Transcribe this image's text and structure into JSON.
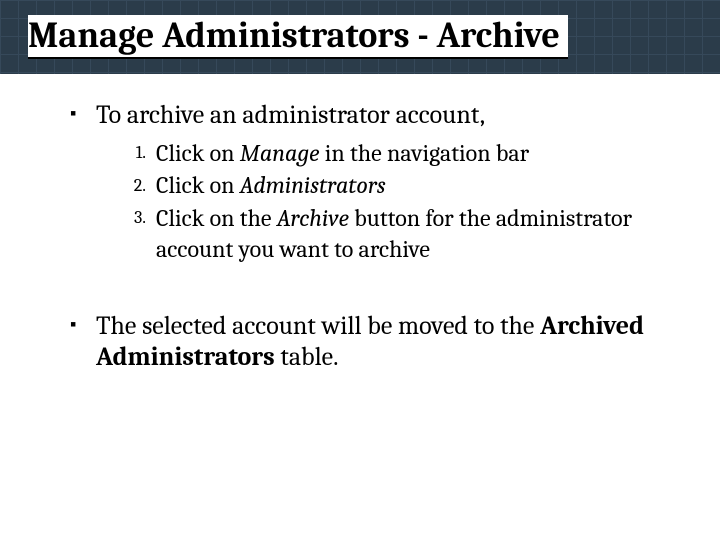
{
  "title": "Manage Administrators - Archive",
  "bullets": [
    {
      "text": "To archive an administrator account,",
      "steps": [
        {
          "pre": "Click on ",
          "emph": "Manage",
          "post": " in the navigation bar"
        },
        {
          "pre": "Click on ",
          "emph": "Administrators"
        },
        {
          "pre": "Click on the ",
          "emph": "Archive",
          "post": " button for the administrator account you want to archive"
        }
      ]
    },
    {
      "pre": "The selected account will be moved to the ",
      "bold": "Archived Administrators",
      "post": " table."
    }
  ]
}
